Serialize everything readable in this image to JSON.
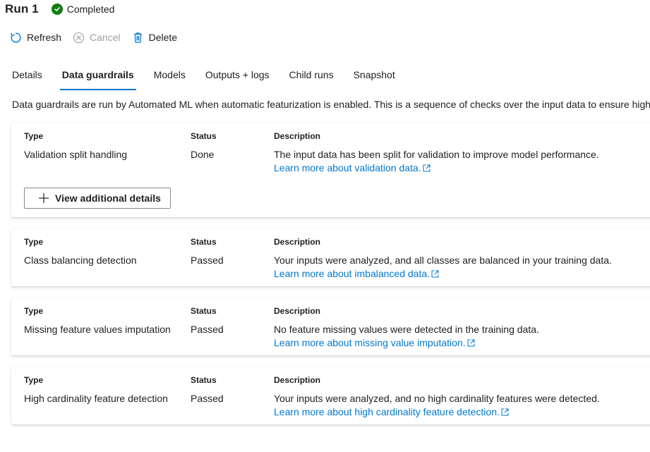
{
  "header": {
    "title": "Run 1",
    "status": "Completed",
    "status_color": "#107c10"
  },
  "toolbar": {
    "refresh_label": "Refresh",
    "cancel_label": "Cancel",
    "delete_label": "Delete"
  },
  "tabs": [
    {
      "label": "Details"
    },
    {
      "label": "Data guardrails"
    },
    {
      "label": "Models"
    },
    {
      "label": "Outputs + logs"
    },
    {
      "label": "Child runs"
    },
    {
      "label": "Snapshot"
    }
  ],
  "active_tab": "Data guardrails",
  "accent_color": "#0078d4",
  "intro_text": "Data guardrails are run by Automated ML when automatic featurization is enabled. This is a sequence of checks over the input data to ensure high",
  "columns": {
    "type": "Type",
    "status": "Status",
    "description": "Description"
  },
  "guardrails": [
    {
      "type": "Validation split handling",
      "status": "Done",
      "description": "The input data has been split for validation to improve model performance.",
      "link": "Learn more about validation data.",
      "button": "View additional details"
    },
    {
      "type": "Class balancing detection",
      "status": "Passed",
      "description": "Your inputs were analyzed, and all classes are balanced in your training data.",
      "link": "Learn more about imbalanced data."
    },
    {
      "type": "Missing feature values imputation",
      "status": "Passed",
      "description": "No feature missing values were detected in the training data.",
      "link": "Learn more about missing value imputation."
    },
    {
      "type": "High cardinality feature detection",
      "status": "Passed",
      "description": "Your inputs were analyzed, and no high cardinality features were detected.",
      "link": "Learn more about high cardinality feature detection."
    }
  ]
}
